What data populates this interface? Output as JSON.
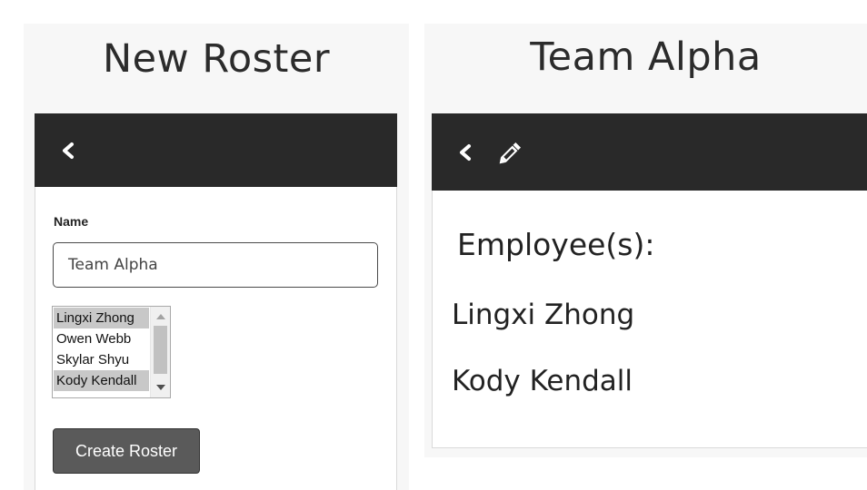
{
  "new_roster": {
    "title": "New Roster",
    "name_label": "Name",
    "name_value": "Team Alpha",
    "employees": [
      {
        "name": "Lingxi Zhong",
        "selected": true
      },
      {
        "name": "Owen Webb",
        "selected": false
      },
      {
        "name": "Skylar Shyu",
        "selected": false
      },
      {
        "name": "Kody Kendall",
        "selected": true
      }
    ],
    "create_label": "Create Roster",
    "toolbar": {
      "back_icon": "chevron-left-icon"
    }
  },
  "team_view": {
    "title": "Team Alpha",
    "employees_heading": "Employee(s):",
    "members": [
      "Lingxi Zhong",
      "Kody Kendall"
    ],
    "toolbar": {
      "back_icon": "chevron-left-icon",
      "edit_icon": "pencil-icon"
    }
  },
  "colors": {
    "toolbar_bg": "#292929",
    "panel_bg": "#f7f7f7",
    "button_bg": "#5a5a5a",
    "selected_option_bg": "#c8c8c8"
  }
}
